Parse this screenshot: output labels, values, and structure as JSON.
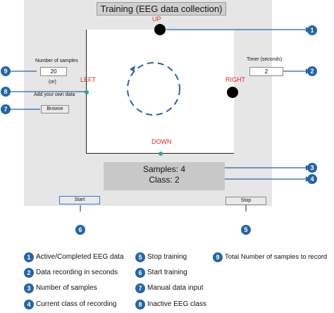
{
  "title": "Training (EEG data collection)",
  "plot": {
    "label_up": "UP",
    "label_down": "DOWN",
    "label_left": "LEFT",
    "label_right": "RIGHT"
  },
  "left_panel": {
    "samples_label": "Number of samples",
    "samples_value": "20",
    "or_label": "(or)",
    "add_data_label": "Add your own data",
    "browse_button": "Browse"
  },
  "right_panel": {
    "timer_label": "Timer (seconds)",
    "timer_value": "2"
  },
  "status": {
    "samples_text": "Samples: 4",
    "class_text": "Class: 2"
  },
  "buttons": {
    "start": "Start",
    "stop": "Stop"
  },
  "callouts": [
    "1",
    "2",
    "3",
    "4",
    "5",
    "6",
    "7",
    "8",
    "9"
  ],
  "legend": [
    {
      "num": "1",
      "text": "Active/Completed EEG data"
    },
    {
      "num": "2",
      "text": "Data recording in seconds"
    },
    {
      "num": "3",
      "text": "Number of samples"
    },
    {
      "num": "4",
      "text": "Current class of recording"
    },
    {
      "num": "5",
      "text": "Stop training"
    },
    {
      "num": "6",
      "text": "Start training"
    },
    {
      "num": "7",
      "text": "Manual data input"
    },
    {
      "num": "8",
      "text": "Inactive EEG class"
    },
    {
      "num": "9",
      "text": "Total Number of samples to record"
    }
  ],
  "colors": {
    "callout": "#2366a8",
    "direction_label": "#d62828",
    "marker_teal": "#2aa6a0",
    "panel": "#e6e6e6"
  }
}
